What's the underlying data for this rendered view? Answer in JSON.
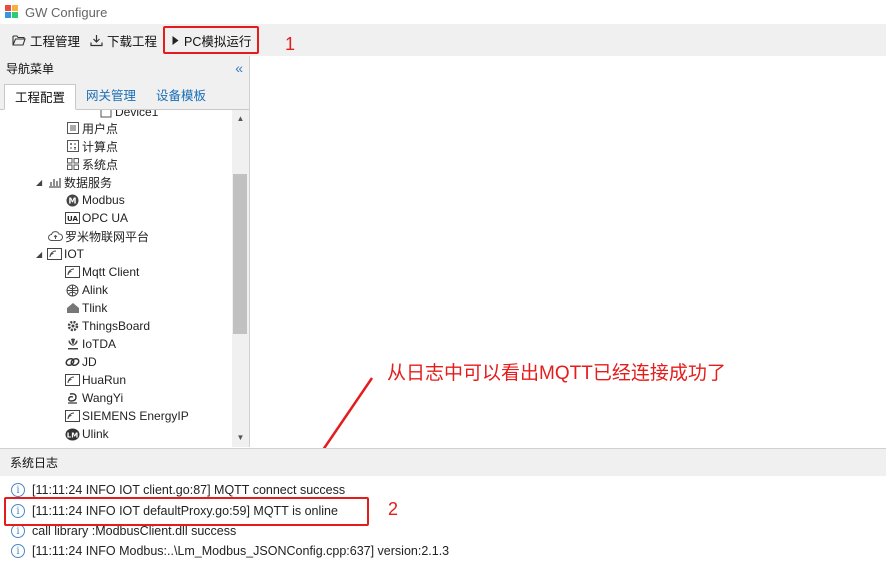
{
  "window": {
    "title": "GW Configure"
  },
  "toolbar": {
    "project_manage": "工程管理",
    "download_project": "下载工程",
    "pc_simulate": "PC模拟运行"
  },
  "callouts": {
    "one": "1",
    "two": "2",
    "annotation": "从日志中可以看出MQTT已经连接成功了"
  },
  "nav": {
    "header": "导航菜单",
    "tabs": [
      "工程配置",
      "网关管理",
      "设备模板"
    ],
    "tree": {
      "device_partial": "Device1",
      "user_point": "用户点",
      "calc_point": "计算点",
      "system_point": "系统点",
      "data_service": "数据服务",
      "modbus": "Modbus",
      "opc_ua": "OPC UA",
      "lumi_platform": "罗米物联网平台",
      "iot": "IOT",
      "mqtt_client": "Mqtt Client",
      "alink": "Alink",
      "tlink": "Tlink",
      "thingsboard": "ThingsBoard",
      "iotda": "IoTDA",
      "jd": "JD",
      "huarun": "HuaRun",
      "wangyi": "WangYi",
      "siemens": "SIEMENS EnergyIP",
      "ulink": "Ulink"
    }
  },
  "log": {
    "header": "系统日志",
    "lines": [
      "[11:11:24 INFO IOT client.go:87] MQTT connect success",
      "[11:11:24 INFO IOT defaultProxy.go:59] MQTT is online",
      "call library :ModbusClient.dll success",
      "[11:11:24 INFO Modbus:..\\Lm_Modbus_JSONConfig.cpp:637] version:2.1.3"
    ]
  },
  "colors": {
    "accent_red": "#e51c1c",
    "tab_blue": "#1a6fb5",
    "info_blue": "#4a88c7"
  }
}
